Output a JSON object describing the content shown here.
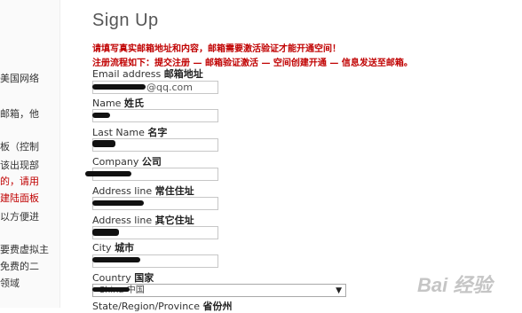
{
  "sidebar": {
    "lines": [
      "美国网络",
      "邮箱，他",
      "板（控制",
      "该出现部",
      "的，请用",
      "建陆面板",
      "以方便进",
      "要费虚拟主",
      "免费的二",
      "领域"
    ]
  },
  "form": {
    "title": "Sign Up",
    "notice_1": "请填写真实邮箱地址和内容，邮箱需要激活验证才能开通空间！",
    "notice_2": "注册流程如下：提交注册 — 邮箱验证激活 — 空间创建开通 — 信息发送至邮箱。",
    "email_label": "Email address",
    "email_label_cn": "邮箱地址",
    "email_value": "@qq.com",
    "name_label": "Name",
    "name_label_cn": "姓氏",
    "lastname_label": "Last Name",
    "lastname_label_cn": "名字",
    "company_label": "Company",
    "company_label_cn": "公司",
    "address1_label": "Address line",
    "address1_label_cn": "常住住址",
    "address2_label": "Address line",
    "address2_label_cn": "其它住址",
    "city_label": "City",
    "city_label_cn": "城市",
    "country_label": "Country",
    "country_label_cn": "国家",
    "country_value": "China 中国",
    "state_label": "State/Region/Province",
    "state_label_cn": "省份州"
  },
  "watermark": "Bai 经验"
}
